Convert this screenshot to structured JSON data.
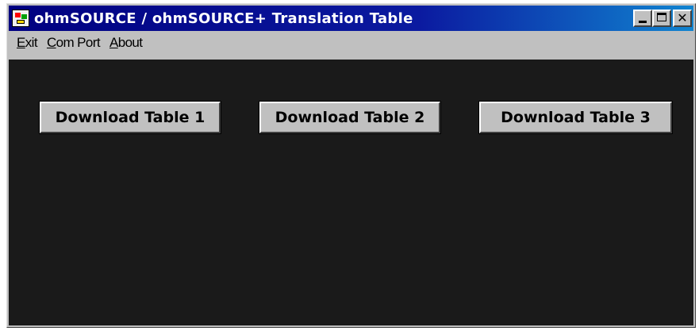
{
  "window": {
    "title": "ohmSOURCE / ohmSOURCE+  Translation  Table",
    "app_icon": "app-icon",
    "controls": {
      "minimize": "minimize-icon",
      "maximize": "maximize-icon",
      "close": "close-icon",
      "close_glyph": "✕"
    }
  },
  "menu": {
    "items": [
      {
        "label_accel": "E",
        "label_rest": "xit"
      },
      {
        "label_accel": "C",
        "label_rest": "om Port"
      },
      {
        "label_accel": "A",
        "label_rest": "bout"
      }
    ]
  },
  "main": {
    "buttons": [
      {
        "label": "Download Table 1"
      },
      {
        "label": "Download Table 2"
      },
      {
        "label": "Download Table 3"
      }
    ]
  },
  "colors": {
    "titlebar": "#000080",
    "client_background": "#1a1a1a",
    "button_face": "#c0c0c0"
  }
}
